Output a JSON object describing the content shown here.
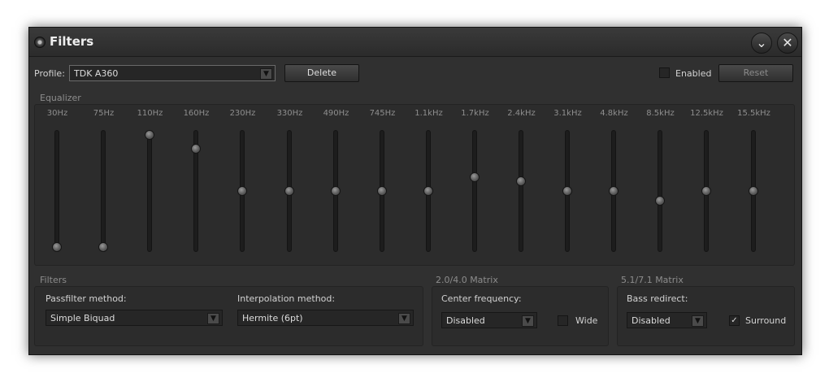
{
  "window": {
    "title": "Filters"
  },
  "profile": {
    "label": "Profile:",
    "value": "TDK A360",
    "delete_label": "Delete"
  },
  "enabled": {
    "label": "Enabled",
    "checked": false
  },
  "reset_label": "Reset",
  "equalizer": {
    "label": "Equalizer",
    "range": [
      0,
      1
    ],
    "bands": [
      {
        "label": "30Hz",
        "level": 0.0
      },
      {
        "label": "75Hz",
        "level": 0.0
      },
      {
        "label": "110Hz",
        "level": 1.0
      },
      {
        "label": "160Hz",
        "level": 0.88
      },
      {
        "label": "230Hz",
        "level": 0.5
      },
      {
        "label": "330Hz",
        "level": 0.5
      },
      {
        "label": "490Hz",
        "level": 0.5
      },
      {
        "label": "745Hz",
        "level": 0.5
      },
      {
        "label": "1.1kHz",
        "level": 0.5
      },
      {
        "label": "1.7kHz",
        "level": 0.62
      },
      {
        "label": "2.4kHz",
        "level": 0.59
      },
      {
        "label": "3.1kHz",
        "level": 0.5
      },
      {
        "label": "4.8kHz",
        "level": 0.5
      },
      {
        "label": "8.5kHz",
        "level": 0.41
      },
      {
        "label": "12.5kHz",
        "level": 0.5
      },
      {
        "label": "15.5kHz",
        "level": 0.5
      }
    ]
  },
  "filters": {
    "label": "Filters",
    "passfilter_label": "Passfilter method:",
    "passfilter_value": "Simple Biquad",
    "interpolation_label": "Interpolation method:",
    "interpolation_value": "Hermite (6pt)"
  },
  "matrix_2040": {
    "label": "2.0/4.0 Matrix",
    "center_label": "Center frequency:",
    "center_value": "Disabled",
    "wide_label": "Wide",
    "wide_checked": false
  },
  "matrix_5171": {
    "label": "5.1/7.1 Matrix",
    "bass_label": "Bass redirect:",
    "bass_value": "Disabled",
    "surround_label": "Surround",
    "surround_checked": true,
    "check_glyph": "✓"
  },
  "icons": {
    "collapse": "⌄",
    "close": "✕",
    "dropdown": "▼"
  }
}
